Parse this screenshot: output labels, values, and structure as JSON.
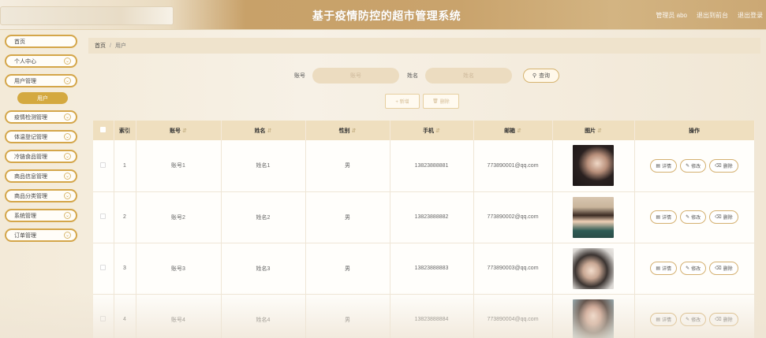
{
  "header": {
    "title": "基于疫情防控的超市管理系统",
    "links": [
      "管理员 abo",
      "退出到前台",
      "退出登录"
    ]
  },
  "sidebar": {
    "items": [
      {
        "label": "首页",
        "chevron": false
      },
      {
        "label": "个人中心",
        "chevron": true
      },
      {
        "label": "用户管理",
        "chevron": true,
        "sub": "用户"
      },
      {
        "label": "疫情检测管理",
        "chevron": true
      },
      {
        "label": "体温登记管理",
        "chevron": true
      },
      {
        "label": "冷链食品管理",
        "chevron": true
      },
      {
        "label": "商品信息管理",
        "chevron": true
      },
      {
        "label": "商品分类管理",
        "chevron": true
      },
      {
        "label": "系统管理",
        "chevron": true
      },
      {
        "label": "订单管理",
        "chevron": true
      }
    ]
  },
  "breadcrumb": {
    "home": "首页",
    "sep": "/",
    "current": "用户"
  },
  "search": {
    "account_label": "账号",
    "account_placeholder": "账号",
    "name_label": "姓名",
    "name_placeholder": "姓名",
    "query_label": "查询"
  },
  "actions": {
    "add": "+ 新增",
    "delete": "删除"
  },
  "table": {
    "columns": [
      "索引",
      "账号",
      "姓名",
      "性别",
      "手机",
      "邮箱",
      "图片",
      "操作"
    ],
    "ops": {
      "detail": "详情",
      "edit": "修改",
      "delete": "删除"
    },
    "rows": [
      {
        "idx": "1",
        "account": "账号1",
        "name": "姓名1",
        "gender": "男",
        "phone": "13823888881",
        "email": "773890001@qq.com"
      },
      {
        "idx": "2",
        "account": "账号2",
        "name": "姓名2",
        "gender": "男",
        "phone": "13823888882",
        "email": "773890002@qq.com"
      },
      {
        "idx": "3",
        "account": "账号3",
        "name": "姓名3",
        "gender": "男",
        "phone": "13823888883",
        "email": "773890003@qq.com"
      },
      {
        "idx": "4",
        "account": "账号4",
        "name": "姓名4",
        "gender": "男",
        "phone": "13823888884",
        "email": "773890004@qq.com"
      }
    ]
  },
  "colors": {
    "accent": "#d4a940",
    "header_bg": "#efdfbf",
    "topbar": "#c9a36c"
  }
}
